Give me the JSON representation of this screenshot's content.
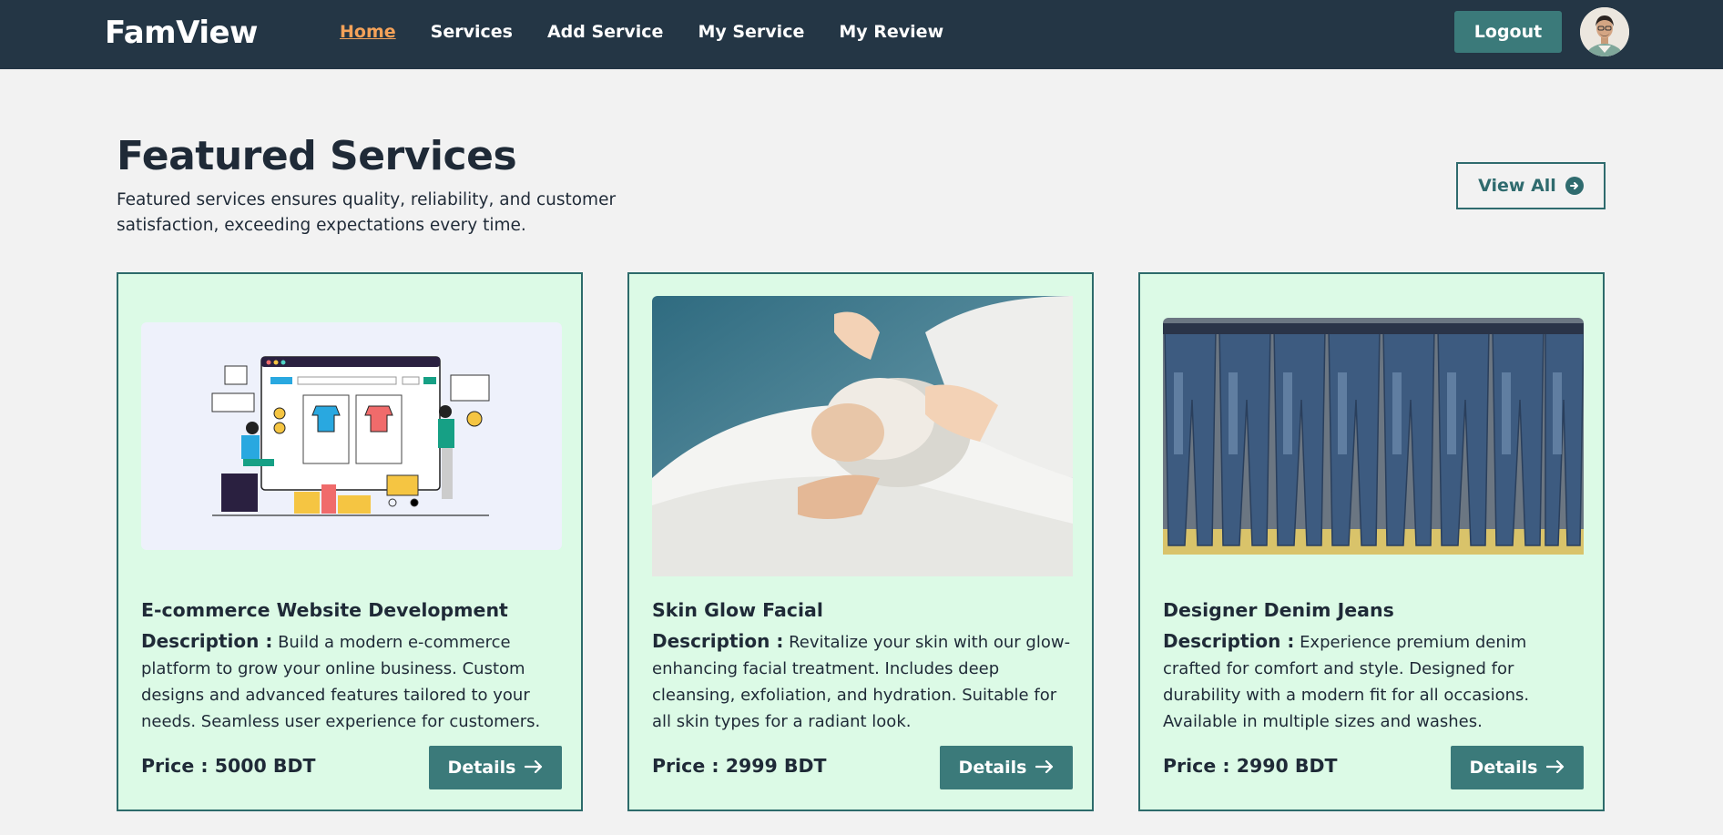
{
  "navbar": {
    "brand": "FamView",
    "links": [
      {
        "label": "Home",
        "active": true
      },
      {
        "label": "Services",
        "active": false
      },
      {
        "label": "Add Service",
        "active": false
      },
      {
        "label": "My Service",
        "active": false
      },
      {
        "label": "My Review",
        "active": false
      }
    ],
    "logout_label": "Logout",
    "avatar_icon": "user-avatar"
  },
  "section": {
    "title": "Featured Services",
    "subtitle": "Featured services ensures quality, reliability, and customer satisfaction, exceeding expectations every time.",
    "view_all_label": "View All"
  },
  "cards": [
    {
      "title": "E-commerce Website Development",
      "desc_label": "Description :",
      "description": "Build a modern e-commerce platform to grow your online business. Custom designs and advanced features tailored to your needs. Seamless user experience for customers.",
      "price": "Price : 5000 BDT",
      "button": "Details",
      "image": "ecommerce-illustration"
    },
    {
      "title": "Skin Glow Facial",
      "desc_label": "Description :",
      "description": "Revitalize your skin with our glow-enhancing facial treatment. Includes deep cleansing, exfoliation, and hydration. Suitable for all skin types for a radiant look.",
      "price": "Price : 2999 BDT",
      "button": "Details",
      "image": "facial-treatment-photo"
    },
    {
      "title": "Designer Denim Jeans",
      "desc_label": "Description :",
      "description": "Experience premium denim crafted for comfort and style. Designed for durability with a modern fit for all occasions. Available in multiple sizes and washes.",
      "price": "Price : 2990 BDT",
      "button": "Details",
      "image": "denim-jeans-photo"
    }
  ],
  "colors": {
    "navbar_bg": "#243645",
    "accent": "#3b7a7a",
    "active_link": "#f4a259",
    "card_bg": "#dcfae6",
    "card_border": "#2d6b6b"
  }
}
